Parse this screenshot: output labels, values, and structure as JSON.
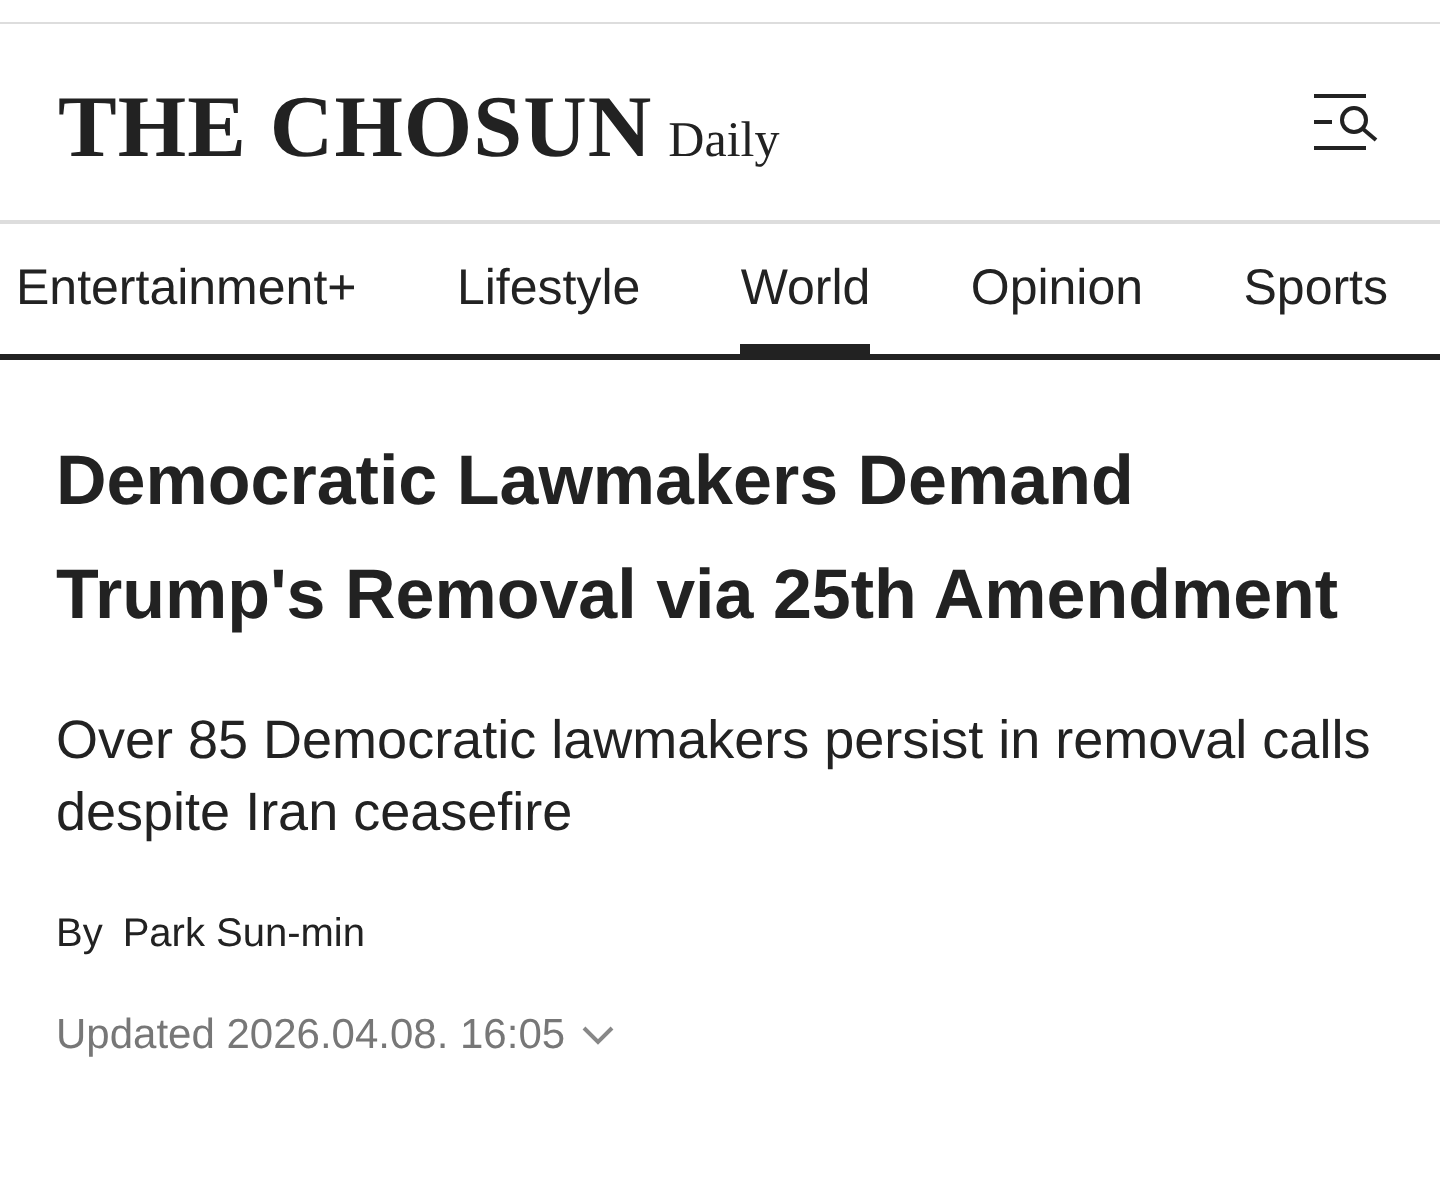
{
  "logo": {
    "name": "THE CHOSUN",
    "suffix": "Daily"
  },
  "nav": [
    {
      "label": "Entertainment+",
      "selected": false
    },
    {
      "label": "Lifestyle",
      "selected": false
    },
    {
      "label": "World",
      "selected": true
    },
    {
      "label": "Opinion",
      "selected": false
    },
    {
      "label": "Sports",
      "selected": false
    }
  ],
  "article": {
    "headline": "Democratic Lawmakers Demand Trump's Removal via 25th Amendment",
    "subtitle": "Over 85 Democratic lawmakers persist in removal calls despite Iran ceasefire",
    "byline_prefix": "By",
    "author": "Park Sun-min",
    "updated": "Updated 2026.04.08. 16:05"
  }
}
